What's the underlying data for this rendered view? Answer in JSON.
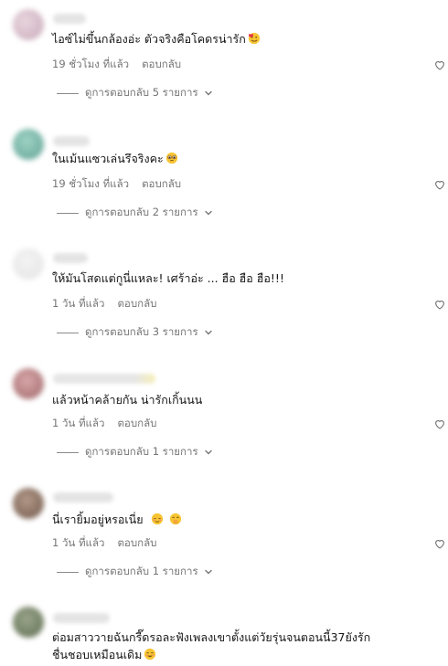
{
  "comments": [
    {
      "text": "ไอซ์ไม่ขึ้นกล้องอ่ะ ตัวจริงคือโคดรน่ารัก",
      "time": "19 ชั่วโมง ที่แล้ว",
      "reply": "ตอบกลับ",
      "view_replies": "ดูการตอบกลับ 5 รายการ",
      "emoji": "smiling-face-with-hearts"
    },
    {
      "text": "ในเม้นแซวเล่นรึจริงคะ",
      "time": "19 ชั่วโมง ที่แล้ว",
      "reply": "ตอบกลับ",
      "view_replies": "ดูการตอบกลับ 2 รายการ",
      "emoji": "pleading-face"
    },
    {
      "text": "ให้มันโสดแต่กูนี่แหละ! เศร้าอ่ะ ... ฮือ ฮือ ฮือ!!!",
      "time": "1 วัน ที่แล้ว",
      "reply": "ตอบกลับ",
      "view_replies": "ดูการตอบกลับ 3 รายการ"
    },
    {
      "text": "แล้วหน้าคล้ายกัน น่ารักเกิ้นนน",
      "time": "1 วัน ที่แล้ว",
      "reply": "ตอบกลับ",
      "view_replies": "ดูการตอบกลับ 1 รายการ"
    },
    {
      "text": "นี่เรายิ้มอยู่หรอเนี่ย",
      "time": "1 วัน ที่แล้ว",
      "reply": "ตอบกลับ",
      "view_replies": "ดูการตอบกลับ 1 รายการ",
      "emoji": "relieved-face, face-with-hand-over-mouth"
    },
    {
      "text": "ต่อมสาววายฉันกรี๊ดรอละฟังเพลงเขาตั้งแต่วัยรุ่นจนตอนนี้37ยังรัก\nชื่นชอบเหมือนเดิม",
      "emoji": "smiling-face-with-smiling-eyes"
    }
  ],
  "icons": {
    "like": "heart-outline-icon",
    "expand": "chevron-down-icon"
  },
  "colors": {
    "text": "#161616",
    "meta": "#757575"
  }
}
